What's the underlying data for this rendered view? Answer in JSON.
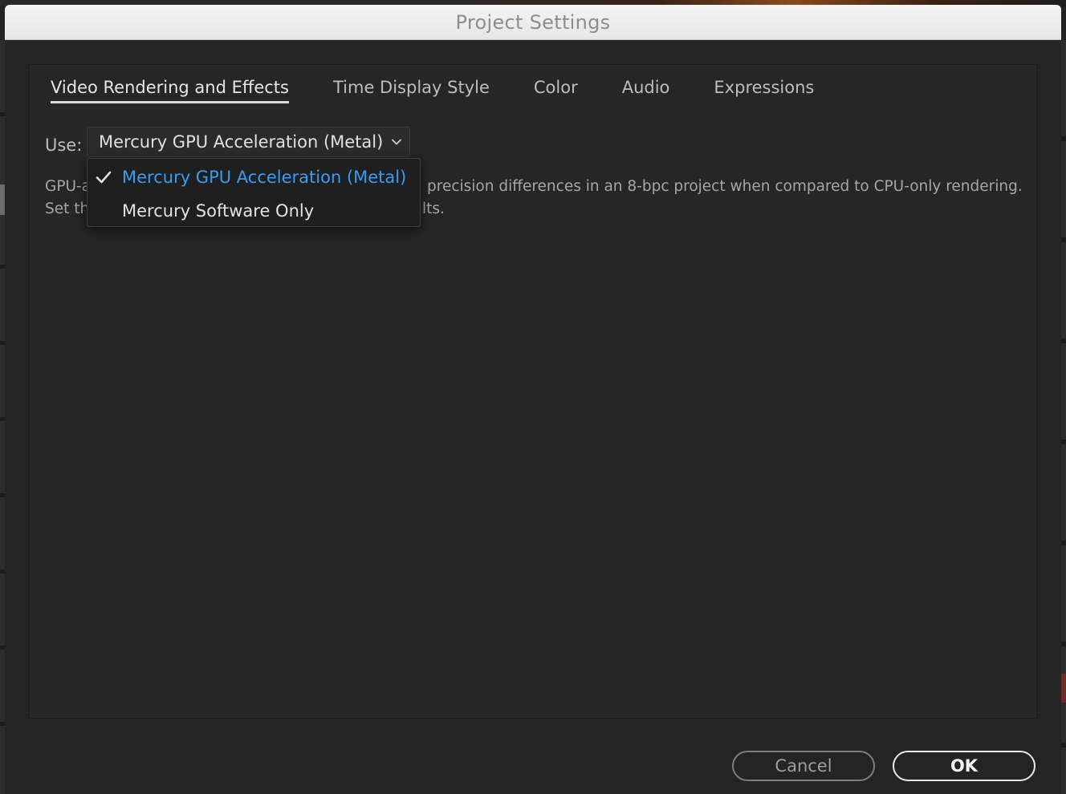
{
  "dialog": {
    "title": "Project Settings"
  },
  "tabs": [
    {
      "label": "Video Rendering and Effects",
      "active": true
    },
    {
      "label": "Time Display Style",
      "active": false
    },
    {
      "label": "Color",
      "active": false
    },
    {
      "label": "Audio",
      "active": false
    },
    {
      "label": "Expressions",
      "active": false
    }
  ],
  "rendering": {
    "use_label": "Use:",
    "selected_value": "Mercury GPU Acceleration (Metal)",
    "description_line1_left": "GPU-a",
    "description_line1_right": "precision differences in an 8-bpc project when compared to CPU-only rendering.",
    "description_line2_left": "Set th",
    "description_line2_right": "lts."
  },
  "dropdown": {
    "options": [
      {
        "label": "Mercury GPU Acceleration (Metal)",
        "checked": true
      },
      {
        "label": "Mercury Software Only",
        "checked": false
      }
    ]
  },
  "buttons": {
    "cancel_label": "Cancel",
    "ok_label": "OK"
  },
  "colors": {
    "accent_selected": "#3a9cf0",
    "dialog_bg": "#242424",
    "titlebar_bg": "#e6e6e6"
  },
  "icons": {
    "dropdown": "chevron-down-icon",
    "selected_option": "checkmark-icon"
  }
}
